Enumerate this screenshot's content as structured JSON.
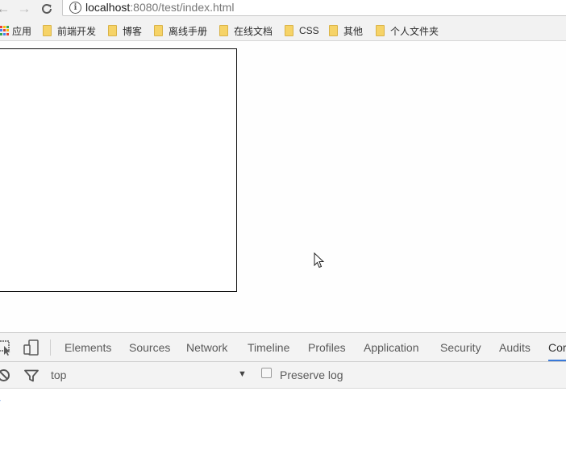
{
  "browser": {
    "url_host": "localhost",
    "url_rest": ":8080/test/index.html",
    "nav_icons": [
      "back-icon",
      "forward-icon",
      "reload-icon",
      "info-icon"
    ]
  },
  "bookmarks": {
    "apps_label": "应用",
    "items": [
      "前端开发",
      "博客",
      "离线手册",
      "在线文档",
      "CSS",
      "其他",
      "个人文件夹"
    ]
  },
  "devtools": {
    "tabs": [
      "Elements",
      "Sources",
      "Network",
      "Timeline",
      "Profiles",
      "Application",
      "Security",
      "Audits",
      "Cor"
    ],
    "active_tab": "Cor",
    "context": "top",
    "preserve_log_label": "Preserve log",
    "preserve_log_checked": false,
    "accent_color": "#3879d9"
  }
}
